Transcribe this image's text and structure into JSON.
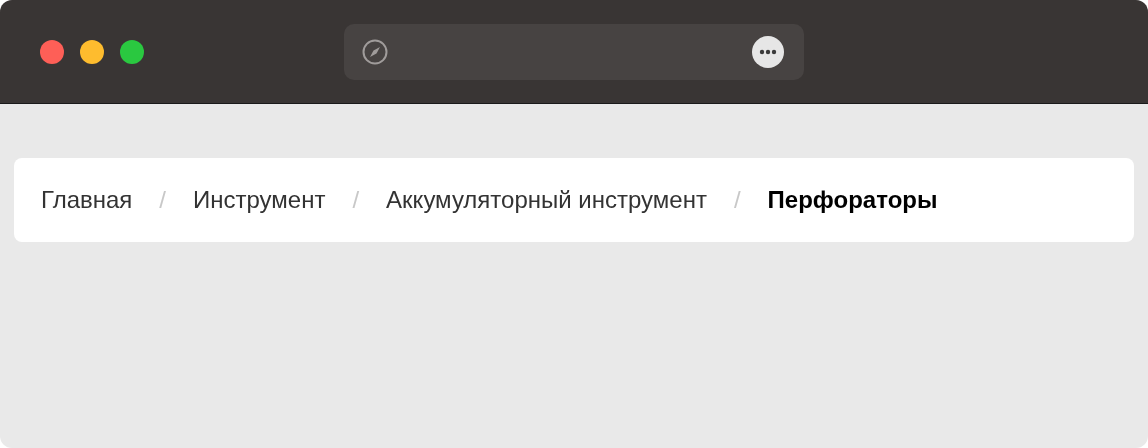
{
  "breadcrumbs": [
    {
      "label": "Главная",
      "current": false,
      "separator": "/"
    },
    {
      "label": "Инструмент",
      "current": false,
      "separator": "/"
    },
    {
      "label": "Аккумуляторный инструмент",
      "current": false,
      "separator": "/"
    },
    {
      "label": "Перфораторы",
      "current": true
    }
  ]
}
